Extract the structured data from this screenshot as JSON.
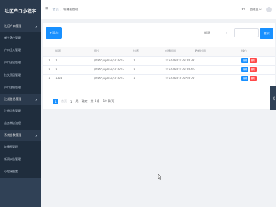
{
  "app": {
    "title": "社区户口小程序"
  },
  "sidebar": {
    "groups": [
      {
        "label": "社区户口管理",
        "items": [
          "新生落户管理",
          "户口迁入管理",
          "户口迁出管理",
          "挂失原因管理",
          "户口注销管理"
        ]
      },
      {
        "label": "注册信息管理",
        "items": [
          "注册信息管理",
          "业务审核流程"
        ]
      },
      {
        "label": "系统参数管理",
        "items": [
          "轮播图管理",
          "新闻公告管理",
          "小程序配置"
        ]
      }
    ]
  },
  "header": {
    "breadcrumb_home": "首页",
    "breadcrumb_sep": "/",
    "breadcrumb_current": "轮播图管理",
    "user_label": "管理员",
    "menu_icon": "☰",
    "refresh_icon": "↻"
  },
  "toolbar": {
    "add_label": "添加",
    "search_label": "标题",
    "select_arrow": "∨",
    "search_value": "",
    "search_button": "搜索"
  },
  "table": {
    "columns": [
      "",
      "标题",
      "图片",
      "排序",
      "创建时间",
      "更新时间",
      "操作"
    ],
    "rows": [
      {
        "index": "1",
        "title": "1",
        "image": "/static/upload/202203...",
        "sort": "1",
        "created": "2022-03-01 23:10:32",
        "updated": ""
      },
      {
        "index": "2",
        "title": "2",
        "image": "/static/upload/202203...",
        "sort": "2",
        "created": "2022-03-01 23:10:46",
        "updated": ""
      },
      {
        "index": "3",
        "title": "3333",
        "image": "/static/upload/202203...",
        "sort": "3",
        "created": "2022-03-02 23:50:22",
        "updated": ""
      }
    ],
    "edit_label": "编辑",
    "delete_label": "删除"
  },
  "pagination": {
    "current_page": "1",
    "first": "首页",
    "prev": "1",
    "next": "尾",
    "jump": "确定",
    "total": "共 3 条",
    "page_size": "10 条/页"
  },
  "side_tab": {
    "icon": "《"
  },
  "colors": {
    "sidebar_bg": "#304156",
    "primary": "#1890ff",
    "danger": "#ff4949"
  }
}
